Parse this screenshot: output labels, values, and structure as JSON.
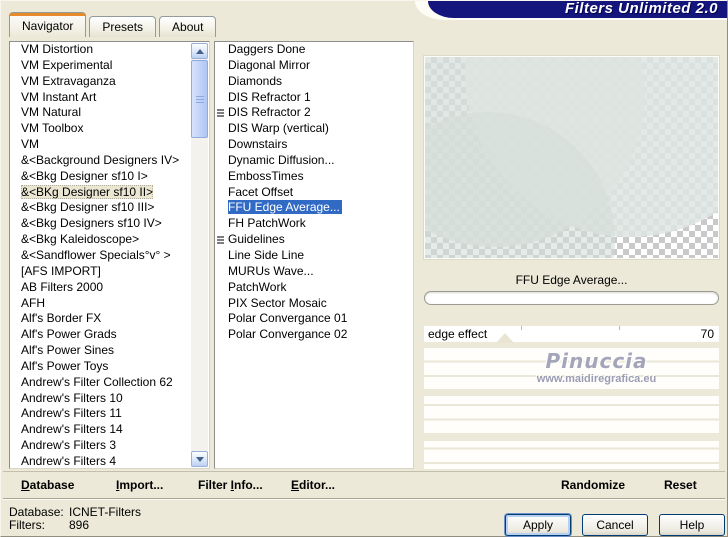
{
  "title": "Filters Unlimited 2.0",
  "tabs": [
    {
      "label": "Navigator",
      "active": true
    },
    {
      "label": "Presets",
      "active": false
    },
    {
      "label": "About",
      "active": false
    }
  ],
  "category_list": {
    "selected_index": 9,
    "items": [
      "VM Distortion",
      "VM Experimental",
      "VM Extravaganza",
      "VM Instant Art",
      "VM Natural",
      "VM Toolbox",
      "VM",
      "&<Background Designers IV>",
      "&<Bkg Designer sf10 I>",
      "&<BKg Designer sf10 II>",
      "&<Bkg Designer sf10 III>",
      "&<Bkg Designers sf10 IV>",
      "&<Bkg Kaleidoscope>",
      "&<Sandflower Specials°v° >",
      "[AFS IMPORT]",
      "AB Filters 2000",
      "AFH",
      "Alf's Border FX",
      "Alf's Power Grads",
      "Alf's Power Sines",
      "Alf's Power Toys",
      "Andrew's Filter Collection 62",
      "Andrew's Filters 10",
      "Andrew's Filters 11",
      "Andrew's Filters 14",
      "Andrew's Filters 3",
      "Andrew's Filters 4"
    ]
  },
  "filter_list": {
    "selected_index": 10,
    "items": [
      {
        "label": "Daggers Done",
        "marked": false
      },
      {
        "label": "Diagonal Mirror",
        "marked": false
      },
      {
        "label": "Diamonds",
        "marked": false
      },
      {
        "label": "DIS Refractor 1",
        "marked": false
      },
      {
        "label": "DIS Refractor 2",
        "marked": true
      },
      {
        "label": "DIS Warp (vertical)",
        "marked": false
      },
      {
        "label": "Downstairs",
        "marked": false
      },
      {
        "label": "Dynamic Diffusion...",
        "marked": false
      },
      {
        "label": "EmbossTimes",
        "marked": false
      },
      {
        "label": "Facet Offset",
        "marked": false
      },
      {
        "label": "FFU Edge Average...",
        "marked": false
      },
      {
        "label": "FH PatchWork",
        "marked": false
      },
      {
        "label": "Guidelines",
        "marked": true
      },
      {
        "label": "Line Side Line",
        "marked": false
      },
      {
        "label": "MURUs Wave...",
        "marked": false
      },
      {
        "label": "PatchWork",
        "marked": false
      },
      {
        "label": "PIX Sector Mosaic",
        "marked": false
      },
      {
        "label": "Polar Convergance 01",
        "marked": false
      },
      {
        "label": "Polar Convergance 02",
        "marked": false
      }
    ]
  },
  "controls": {
    "filter_label": "FFU Edge Average...",
    "slider_label": "edge effect",
    "slider_value": "70"
  },
  "watermark": {
    "line1": "Pinuccia",
    "line2": "www.maidiregrafica.eu"
  },
  "toolbar": {
    "items": [
      {
        "label": "Database",
        "underline": 0
      },
      {
        "label": "Import...",
        "underline": 0
      },
      {
        "label": "Filter Info...",
        "underline": 7
      },
      {
        "label": "Editor...",
        "underline": 0
      },
      {
        "label": "Randomize",
        "underline": -1
      },
      {
        "label": "Reset",
        "underline": -1
      }
    ]
  },
  "status": {
    "database_label": "Database:",
    "database_value": "ICNET-Filters",
    "filters_label": "Filters:",
    "filters_value": "896"
  },
  "action_buttons": {
    "apply": "Apply",
    "cancel": "Cancel",
    "help": "Help"
  },
  "colors": {
    "title_navy": "#15157e",
    "selection_blue": "#316ac5",
    "tab_orange": "#e68b2c",
    "dialog_beige": "#ece9d8"
  }
}
